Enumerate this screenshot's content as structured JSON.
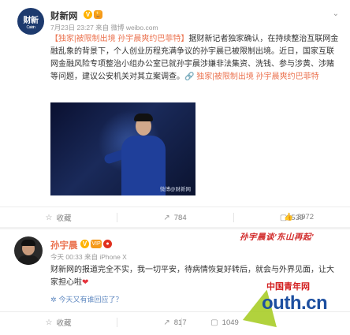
{
  "post": {
    "author": "财新网",
    "avatar_text": "财新",
    "avatar_sub": "Caixin",
    "verified_badge": "V",
    "vip_badge": "🏆",
    "meta": "7月23日 23:27 来自 微博 weibo.com",
    "text_link1": "【独家|被限制出境 孙宇晨爽约巴菲特】",
    "text_body": "据财新记者独家确认，在持续整治互联网金融乱象的背景下，个人创业历程充满争议的孙宇晨已被限制出境。近日，国家互联网金融风险专项整治小组办公室已就孙宇晨涉嫌非法集资、洗钱、参与涉黄、涉赌等问题，建议公安机关对其立案调查。",
    "text_link2": "🔗 独家|被限制出境 孙宇晨爽约巴菲特",
    "photo_watermark": "微博@财新网",
    "actions": [
      {
        "icon": "☆",
        "label": "收藏"
      },
      {
        "icon": "↗",
        "label": "784"
      },
      {
        "icon": "▢",
        "label": "539"
      },
      {
        "icon": "👍",
        "label": "3972"
      }
    ]
  },
  "comment": {
    "author": "孙宇晨",
    "badge1": "V",
    "badge2": "VIP",
    "badge3": "●",
    "meta": "今天 00:33 来自 iPhone X",
    "text": "财新网的报道完全不实，我一切平安，待病情恢复好转后，就会与外界见面，让大家担心啦",
    "heart": "❤",
    "ask_icon": "✲",
    "ask": "今天又有谁回应了？",
    "actions": [
      {
        "icon": "☆",
        "label": "收藏"
      },
      {
        "icon": "↗",
        "label": "817"
      },
      {
        "icon": "▢",
        "label": "1049"
      },
      {
        "icon": "👍",
        "label": ""
      }
    ]
  },
  "overlay": {
    "banner": "孙宇晨谈'东山再起'",
    "logo_line1": "中国青年网",
    "logo_line2": "outh.cn"
  }
}
